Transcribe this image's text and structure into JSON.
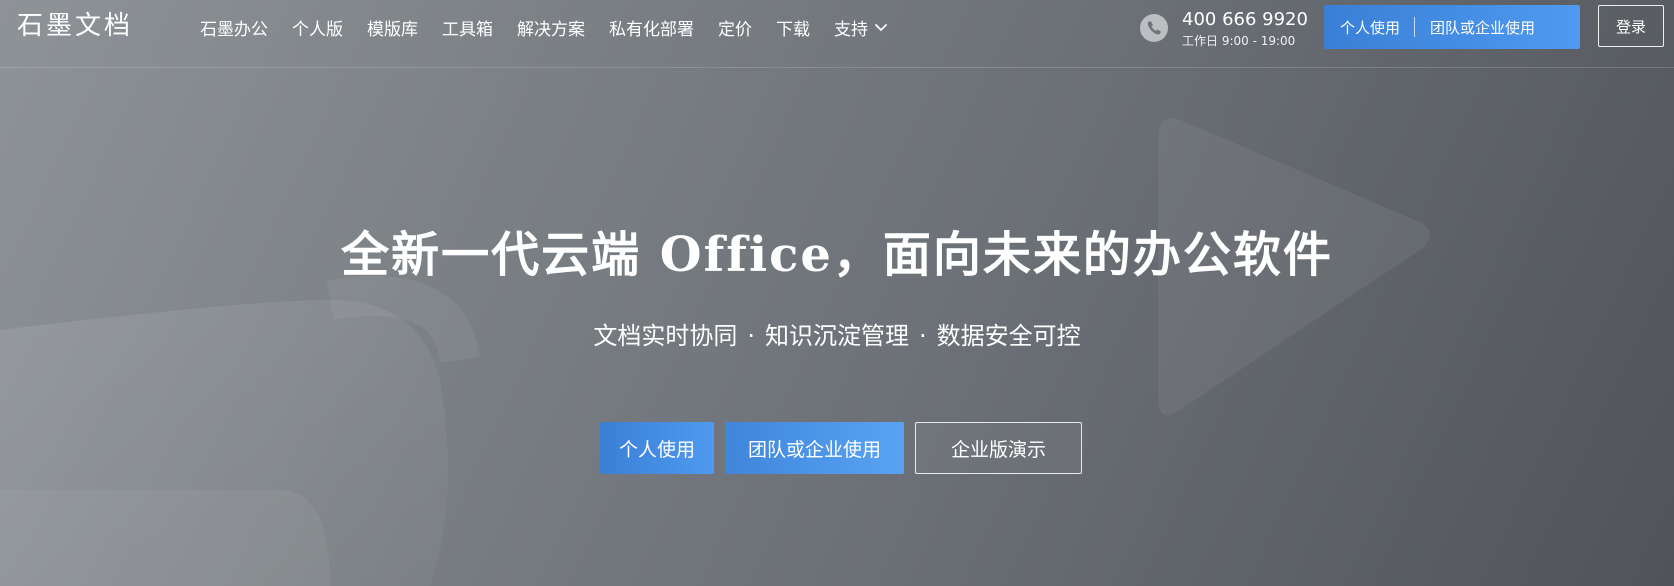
{
  "header": {
    "logo": "石墨文档",
    "nav": [
      {
        "label": "石墨办公"
      },
      {
        "label": "个人版"
      },
      {
        "label": "模版库"
      },
      {
        "label": "工具箱"
      },
      {
        "label": "解决方案"
      },
      {
        "label": "私有化部署"
      },
      {
        "label": "定价"
      },
      {
        "label": "下载"
      },
      {
        "label": "支持"
      }
    ],
    "phone": {
      "number": "400 666 9920",
      "hours": "工作日 9:00 - 19:00"
    },
    "cta_personal": "个人使用",
    "cta_team": "团队或企业使用",
    "login": "登录"
  },
  "hero": {
    "title": "全新一代云端 Office，面向未来的办公软件",
    "subtitle_parts": [
      "文档实时协同",
      "知识沉淀管理",
      "数据安全可控"
    ],
    "subtitle_separator": "·",
    "buttons": {
      "personal": "个人使用",
      "team": "团队或企业使用",
      "demo": "企业版演示"
    }
  },
  "colors": {
    "accent_blue": "#3a7fd6",
    "accent_blue_light": "#4f9af0",
    "text": "#ffffff"
  },
  "icons": [
    "phone-icon",
    "chevron-down-icon"
  ]
}
